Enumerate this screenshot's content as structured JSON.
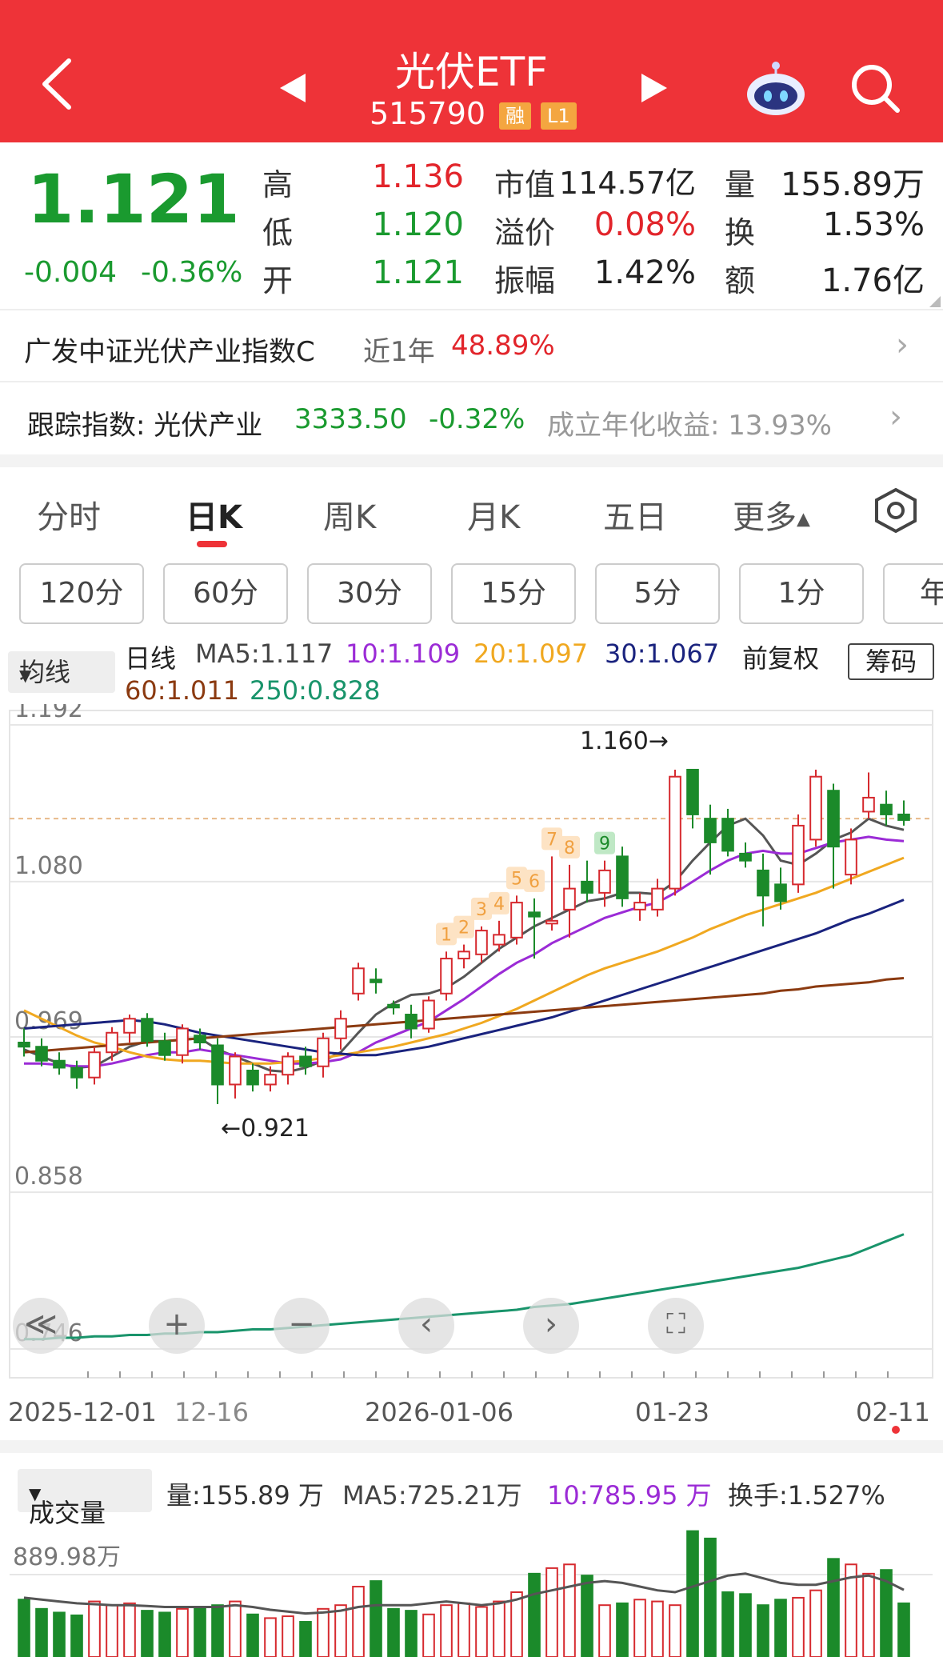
{
  "header": {
    "title": "光伏ETF",
    "code": "515790",
    "badge_margin": "融",
    "badge_level": "L1"
  },
  "quote": {
    "price": "1.121",
    "change": "-0.004",
    "change_pct": "-0.36%",
    "high_label": "高",
    "high": "1.136",
    "low_label": "低",
    "low": "1.120",
    "open_label": "开",
    "open": "1.121",
    "mktcap_label": "市值",
    "mktcap": "114.57亿",
    "premium_label": "溢价",
    "premium": "0.08%",
    "amplitude_label": "振幅",
    "amplitude": "1.42%",
    "volume_label": "量",
    "volume": "155.89万",
    "turnover_label": "换",
    "turnover": "1.53%",
    "amount_label": "额",
    "amount": "1.76亿"
  },
  "fund": {
    "name": "广发中证光伏产业指数C",
    "period": "近1年",
    "return": "48.89%"
  },
  "tracking": {
    "label": "跟踪指数: 光伏产业",
    "value": "3333.50",
    "change": "-0.32%",
    "annual": "成立年化收益: 13.93%"
  },
  "tabs": [
    "分时",
    "日K",
    "周K",
    "月K",
    "五日",
    "更多"
  ],
  "periods": [
    "120分",
    "60分",
    "30分",
    "15分",
    "5分",
    "1分",
    "年"
  ],
  "ma": {
    "select": "均线",
    "type": "日线",
    "ma5": "MA5:1.117",
    "ma10": "10:1.109",
    "ma20": "20:1.097",
    "ma30": "30:1.067",
    "ma60": "60:1.011",
    "ma250": "250:0.828",
    "adjust": "前复权",
    "chips": "筹码"
  },
  "colors": {
    "up": "#d62a2f",
    "down": "#1b8a2a",
    "ma5": "#555555",
    "ma10": "#9b2bd6",
    "ma20": "#f0a820",
    "ma30": "#1a237e",
    "ma60": "#8b3a10",
    "ma250": "#19946b"
  },
  "chart_data": {
    "type": "candlestick",
    "y_ticks": [
      "1.192",
      "1.080",
      "0.969",
      "0.858",
      "0.746"
    ],
    "ylim": [
      0.746,
      1.192
    ],
    "x_ticks": [
      "2025-12-01",
      "12-16",
      "2026-01-06",
      "01-23",
      "02-11"
    ],
    "max_label": "1.160→",
    "min_label": "←0.921",
    "ref_price": 1.125,
    "td_setup_up": [
      "1",
      "2",
      "3",
      "4",
      "5",
      "6",
      "7",
      "8"
    ],
    "td_setup_down": [
      "9"
    ],
    "candles": [
      [
        0.965,
        0.975,
        0.955,
        0.962
      ],
      [
        0.962,
        0.968,
        0.948,
        0.952
      ],
      [
        0.952,
        0.958,
        0.942,
        0.947
      ],
      [
        0.947,
        0.952,
        0.932,
        0.94
      ],
      [
        0.94,
        0.962,
        0.935,
        0.958
      ],
      [
        0.958,
        0.976,
        0.952,
        0.972
      ],
      [
        0.972,
        0.985,
        0.965,
        0.982
      ],
      [
        0.982,
        0.986,
        0.962,
        0.966
      ],
      [
        0.966,
        0.972,
        0.952,
        0.956
      ],
      [
        0.956,
        0.978,
        0.95,
        0.975
      ],
      [
        0.97,
        0.975,
        0.96,
        0.965
      ],
      [
        0.963,
        0.968,
        0.921,
        0.935
      ],
      [
        0.935,
        0.958,
        0.925,
        0.955
      ],
      [
        0.945,
        0.95,
        0.93,
        0.935
      ],
      [
        0.935,
        0.948,
        0.93,
        0.942
      ],
      [
        0.942,
        0.958,
        0.935,
        0.955
      ],
      [
        0.955,
        0.962,
        0.942,
        0.948
      ],
      [
        0.948,
        0.972,
        0.94,
        0.968
      ],
      [
        0.968,
        0.988,
        0.96,
        0.982
      ],
      [
        1.0,
        1.022,
        0.995,
        1.018
      ],
      [
        1.01,
        1.018,
        1.0,
        1.008
      ],
      [
        0.992,
        0.995,
        0.985,
        0.99
      ],
      [
        0.985,
        0.992,
        0.968,
        0.975
      ],
      [
        0.975,
        0.998,
        0.972,
        0.995
      ],
      [
        1.0,
        1.03,
        0.995,
        1.025
      ],
      [
        1.025,
        1.035,
        1.018,
        1.03
      ],
      [
        1.028,
        1.048,
        1.022,
        1.045
      ],
      [
        1.035,
        1.052,
        1.03,
        1.042
      ],
      [
        1.04,
        1.07,
        1.035,
        1.065
      ],
      [
        1.058,
        1.068,
        1.025,
        1.055
      ],
      [
        1.05,
        1.098,
        1.045,
        1.052
      ],
      [
        1.06,
        1.092,
        1.04,
        1.075
      ],
      [
        1.08,
        1.095,
        1.065,
        1.072
      ],
      [
        1.072,
        1.095,
        1.062,
        1.088
      ],
      [
        1.098,
        1.105,
        1.062,
        1.068
      ],
      [
        1.06,
        1.072,
        1.052,
        1.065
      ],
      [
        1.06,
        1.082,
        1.055,
        1.075
      ],
      [
        1.075,
        1.16,
        1.07,
        1.155
      ],
      [
        1.16,
        1.16,
        1.118,
        1.128
      ],
      [
        1.125,
        1.135,
        1.085,
        1.108
      ],
      [
        1.125,
        1.132,
        1.098,
        1.102
      ],
      [
        1.1,
        1.108,
        1.09,
        1.095
      ],
      [
        1.088,
        1.1,
        1.048,
        1.07
      ],
      [
        1.078,
        1.09,
        1.06,
        1.066
      ],
      [
        1.078,
        1.128,
        1.072,
        1.12
      ],
      [
        1.11,
        1.16,
        1.105,
        1.155
      ],
      [
        1.145,
        1.15,
        1.075,
        1.105
      ],
      [
        1.085,
        1.118,
        1.078,
        1.11
      ],
      [
        1.13,
        1.158,
        1.125,
        1.14
      ],
      [
        1.135,
        1.145,
        1.12,
        1.128
      ],
      [
        1.128,
        1.138,
        1.12,
        1.124
      ]
    ],
    "series": [
      {
        "name": "MA5",
        "values": [
          0.96,
          0.955,
          0.95,
          0.947,
          0.948,
          0.955,
          0.962,
          0.966,
          0.966,
          0.967,
          0.968,
          0.96,
          0.955,
          0.95,
          0.945,
          0.944,
          0.947,
          0.952,
          0.958,
          0.972,
          0.985,
          0.993,
          0.999,
          1.0,
          1.004,
          1.012,
          1.022,
          1.032,
          1.04,
          1.048,
          1.054,
          1.06,
          1.066,
          1.068,
          1.072,
          1.072,
          1.071,
          1.08,
          1.095,
          1.108,
          1.12,
          1.125,
          1.113,
          1.095,
          1.092,
          1.1,
          1.11,
          1.115,
          1.125,
          1.12,
          1.117
        ]
      },
      {
        "name": "MA10",
        "values": [
          0.95,
          0.95,
          0.949,
          0.948,
          0.948,
          0.95,
          0.953,
          0.956,
          0.958,
          0.958,
          0.96,
          0.958,
          0.956,
          0.954,
          0.952,
          0.95,
          0.95,
          0.951,
          0.953,
          0.958,
          0.965,
          0.97,
          0.975,
          0.98,
          0.988,
          0.996,
          1.005,
          1.014,
          1.022,
          1.028,
          1.036,
          1.042,
          1.048,
          1.054,
          1.058,
          1.062,
          1.065,
          1.072,
          1.08,
          1.088,
          1.095,
          1.1,
          1.102,
          1.1,
          1.1,
          1.104,
          1.108,
          1.11,
          1.112,
          1.11,
          1.109
        ]
      },
      {
        "name": "MA20",
        "values": [
          0.988,
          0.982,
          0.976,
          0.97,
          0.965,
          0.962,
          0.958,
          0.955,
          0.953,
          0.952,
          0.952,
          0.951,
          0.95,
          0.95,
          0.95,
          0.951,
          0.952,
          0.954,
          0.956,
          0.958,
          0.96,
          0.962,
          0.965,
          0.968,
          0.971,
          0.975,
          0.979,
          0.984,
          0.989,
          0.995,
          1.001,
          1.007,
          1.013,
          1.018,
          1.022,
          1.026,
          1.03,
          1.035,
          1.04,
          1.046,
          1.051,
          1.056,
          1.06,
          1.064,
          1.068,
          1.072,
          1.077,
          1.082,
          1.087,
          1.092,
          1.097
        ]
      },
      {
        "name": "MA30",
        "values": [
          0.975,
          0.976,
          0.977,
          0.978,
          0.979,
          0.98,
          0.981,
          0.98,
          0.978,
          0.975,
          0.972,
          0.97,
          0.968,
          0.966,
          0.964,
          0.962,
          0.96,
          0.958,
          0.957,
          0.956,
          0.956,
          0.958,
          0.96,
          0.962,
          0.965,
          0.968,
          0.971,
          0.974,
          0.977,
          0.98,
          0.983,
          0.987,
          0.991,
          0.995,
          0.999,
          1.003,
          1.007,
          1.011,
          1.015,
          1.019,
          1.023,
          1.027,
          1.031,
          1.035,
          1.039,
          1.043,
          1.048,
          1.053,
          1.057,
          1.062,
          1.067
        ]
      },
      {
        "name": "MA60",
        "values": [
          0.958,
          0.959,
          0.96,
          0.961,
          0.962,
          0.963,
          0.964,
          0.965,
          0.966,
          0.967,
          0.968,
          0.969,
          0.97,
          0.971,
          0.972,
          0.973,
          0.974,
          0.975,
          0.976,
          0.977,
          0.978,
          0.979,
          0.98,
          0.981,
          0.982,
          0.983,
          0.984,
          0.985,
          0.986,
          0.987,
          0.988,
          0.989,
          0.99,
          0.991,
          0.992,
          0.993,
          0.994,
          0.995,
          0.996,
          0.997,
          0.998,
          0.999,
          1.0,
          1.002,
          1.003,
          1.005,
          1.006,
          1.007,
          1.008,
          1.01,
          1.011
        ]
      },
      {
        "name": "MA250",
        "values": [
          0.753,
          0.753,
          0.754,
          0.754,
          0.755,
          0.755,
          0.756,
          0.756,
          0.757,
          0.757,
          0.758,
          0.758,
          0.759,
          0.76,
          0.76,
          0.761,
          0.762,
          0.763,
          0.764,
          0.765,
          0.766,
          0.767,
          0.768,
          0.769,
          0.77,
          0.771,
          0.772,
          0.773,
          0.774,
          0.776,
          0.777,
          0.778,
          0.78,
          0.782,
          0.784,
          0.786,
          0.788,
          0.79,
          0.792,
          0.794,
          0.796,
          0.798,
          0.8,
          0.802,
          0.804,
          0.807,
          0.81,
          0.813,
          0.818,
          0.823,
          0.828
        ]
      }
    ],
    "volume": {
      "select": "成交量",
      "vol": "量:155.89 万",
      "ma5": "MA5:725.21万",
      "ma10": "10:785.95 万",
      "turnover": "换手:1.527%",
      "y_tick": "889.98万",
      "ref_value": 889.98,
      "values": [
        620,
        520,
        480,
        450,
        600,
        560,
        580,
        500,
        480,
        520,
        540,
        560,
        600,
        460,
        420,
        440,
        380,
        520,
        560,
        760,
        820,
        520,
        500,
        460,
        560,
        580,
        540,
        600,
        700,
        900,
        960,
        1000,
        880,
        560,
        580,
        620,
        600,
        560,
        1360,
        1280,
        700,
        680,
        560,
        620,
        640,
        720,
        1060,
        1000,
        900,
        940,
        580
      ],
      "ma5_values": [
        640,
        620,
        600,
        580,
        570,
        560,
        560,
        550,
        540,
        540,
        540,
        540,
        560,
        540,
        510,
        490,
        470,
        480,
        500,
        540,
        560,
        560,
        560,
        580,
        600,
        580,
        560,
        580,
        620,
        680,
        720,
        760,
        800,
        820,
        800,
        760,
        720,
        700,
        760,
        820,
        880,
        900,
        850,
        800,
        780,
        780,
        820,
        860,
        880,
        820,
        725
      ]
    }
  },
  "controls": {
    "rewind": "≪",
    "zoom_in": "+",
    "zoom_out": "−",
    "left": "‹",
    "right": "›",
    "fullscreen": "⛶"
  }
}
